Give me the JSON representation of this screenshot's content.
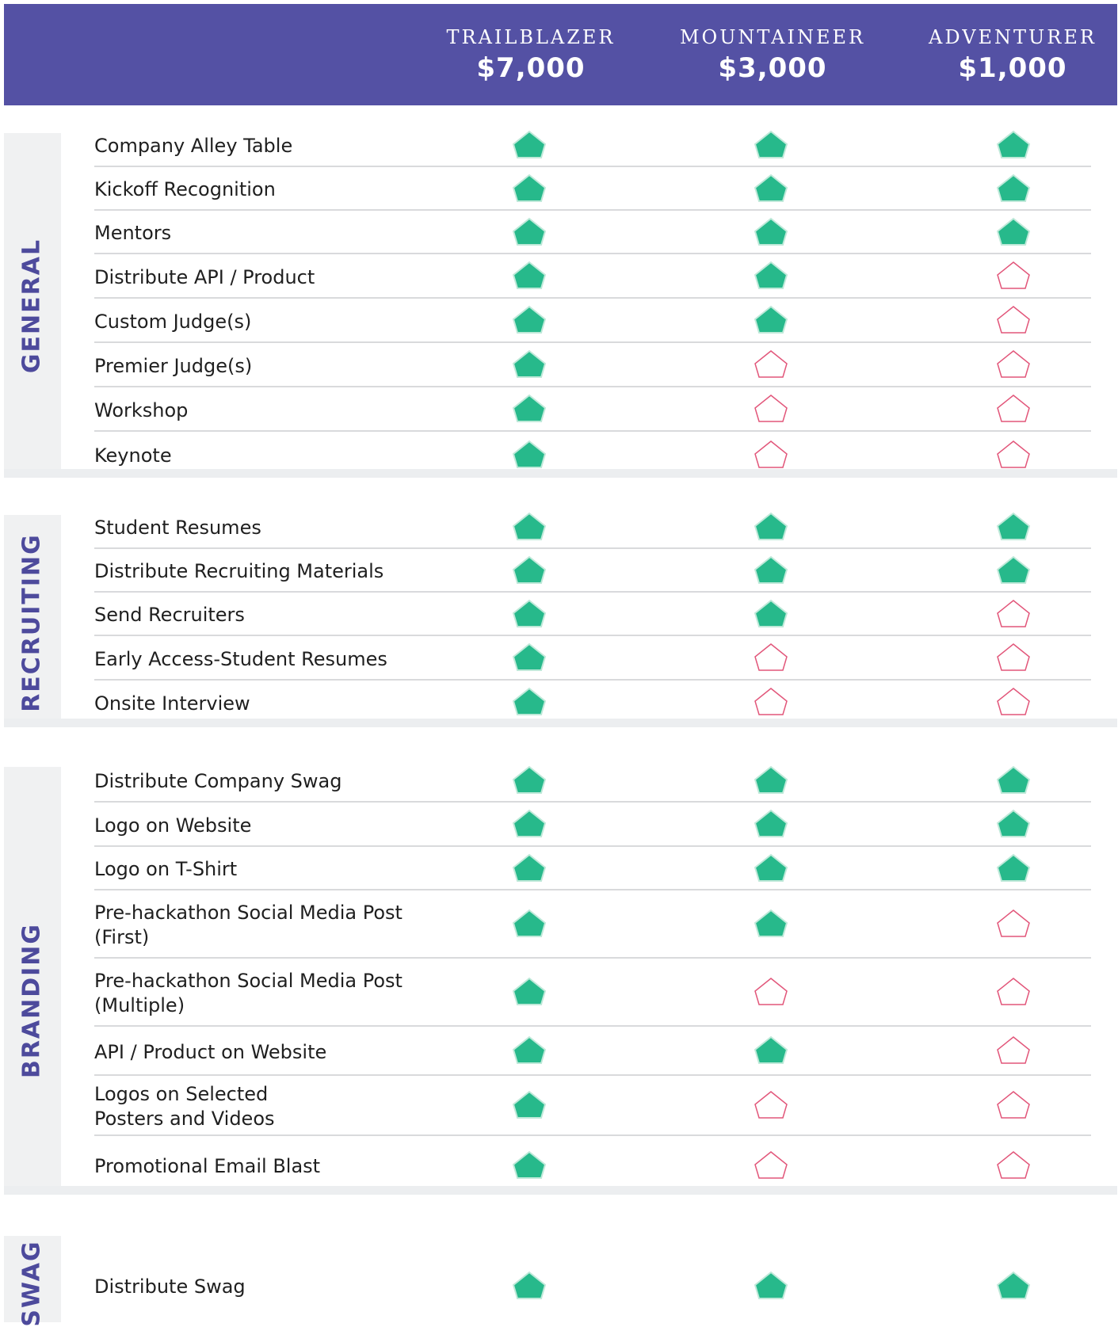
{
  "colors": {
    "header_bg": "#5451a4",
    "section_label": "#4d4a9c",
    "included": "#27b98b",
    "not_included": "#e2567a"
  },
  "icons": {
    "included": "filled-green-pentagon-icon",
    "not_included": "outline-pink-pentagon-icon"
  },
  "tiers": [
    {
      "name": "TRAILBLAZER",
      "price": "$7,000"
    },
    {
      "name": "MOUNTAINEER",
      "price": "$3,000"
    },
    {
      "name": "ADVENTURER",
      "price": "$1,000"
    }
  ],
  "sections": [
    {
      "name": "GENERAL",
      "rows": [
        {
          "label": "Company Alley Table",
          "included": [
            true,
            true,
            true
          ]
        },
        {
          "label": "Kickoff Recognition",
          "included": [
            true,
            true,
            true
          ]
        },
        {
          "label": "Mentors",
          "included": [
            true,
            true,
            true
          ]
        },
        {
          "label": "Distribute API / Product",
          "included": [
            true,
            true,
            false
          ]
        },
        {
          "label": "Custom Judge(s)",
          "included": [
            true,
            true,
            false
          ]
        },
        {
          "label": "Premier Judge(s)",
          "included": [
            true,
            false,
            false
          ]
        },
        {
          "label": "Workshop",
          "included": [
            true,
            false,
            false
          ]
        },
        {
          "label": "Keynote",
          "included": [
            true,
            false,
            false
          ]
        }
      ]
    },
    {
      "name": "RECRUITING",
      "rows": [
        {
          "label": "Student Resumes",
          "included": [
            true,
            true,
            true
          ]
        },
        {
          "label": "Distribute Recruiting Materials",
          "included": [
            true,
            true,
            true
          ]
        },
        {
          "label": "Send Recruiters",
          "included": [
            true,
            true,
            false
          ]
        },
        {
          "label": "Early Access-Student Resumes",
          "included": [
            true,
            false,
            false
          ]
        },
        {
          "label": "Onsite Interview",
          "included": [
            true,
            false,
            false
          ]
        }
      ]
    },
    {
      "name": "BRANDING",
      "rows": [
        {
          "label": "Distribute Company Swag",
          "included": [
            true,
            true,
            true
          ]
        },
        {
          "label": "Logo on Website",
          "included": [
            true,
            true,
            true
          ]
        },
        {
          "label": "Logo on T-Shirt",
          "included": [
            true,
            true,
            true
          ]
        },
        {
          "label": "Pre-hackathon Social Media Post\n(First)",
          "included": [
            true,
            true,
            false
          ]
        },
        {
          "label": "Pre-hackathon Social Media Post\n(Multiple)",
          "included": [
            true,
            false,
            false
          ]
        },
        {
          "label": "API / Product on Website",
          "included": [
            true,
            true,
            false
          ]
        },
        {
          "label": "Logos on Selected\nPosters and Videos",
          "included": [
            true,
            false,
            false
          ]
        },
        {
          "label": "Promotional Email Blast",
          "included": [
            true,
            false,
            false
          ]
        }
      ]
    },
    {
      "name": "SWAG",
      "rows": [
        {
          "label": "Distribute Swag",
          "included": [
            true,
            true,
            true
          ]
        }
      ]
    }
  ]
}
